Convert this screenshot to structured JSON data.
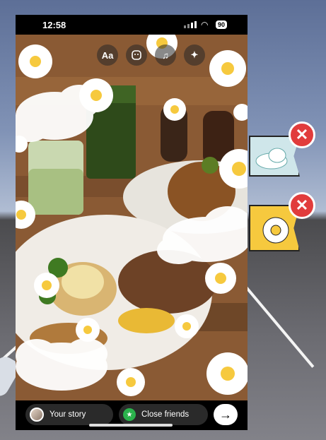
{
  "status_bar": {
    "time": "12:58",
    "battery": "90"
  },
  "toolbar": {
    "text_label": "Aa",
    "sticker_icon": "sticker-icon",
    "music_icon": "music-note-icon",
    "effects_icon": "sparkles-icon"
  },
  "share": {
    "your_story": "Your story",
    "close_friends": "Close friends",
    "send_icon": "arrow-right-icon"
  },
  "sticker_tray": {
    "items": [
      {
        "name": "cloud-sticker"
      },
      {
        "name": "daisy-sticker"
      }
    ],
    "delete_icon": "close-x-icon"
  },
  "colors": {
    "accent_red": "#e13c3c",
    "close_friends_green": "#2bb24c",
    "daisy_yellow": "#f6c93e"
  }
}
